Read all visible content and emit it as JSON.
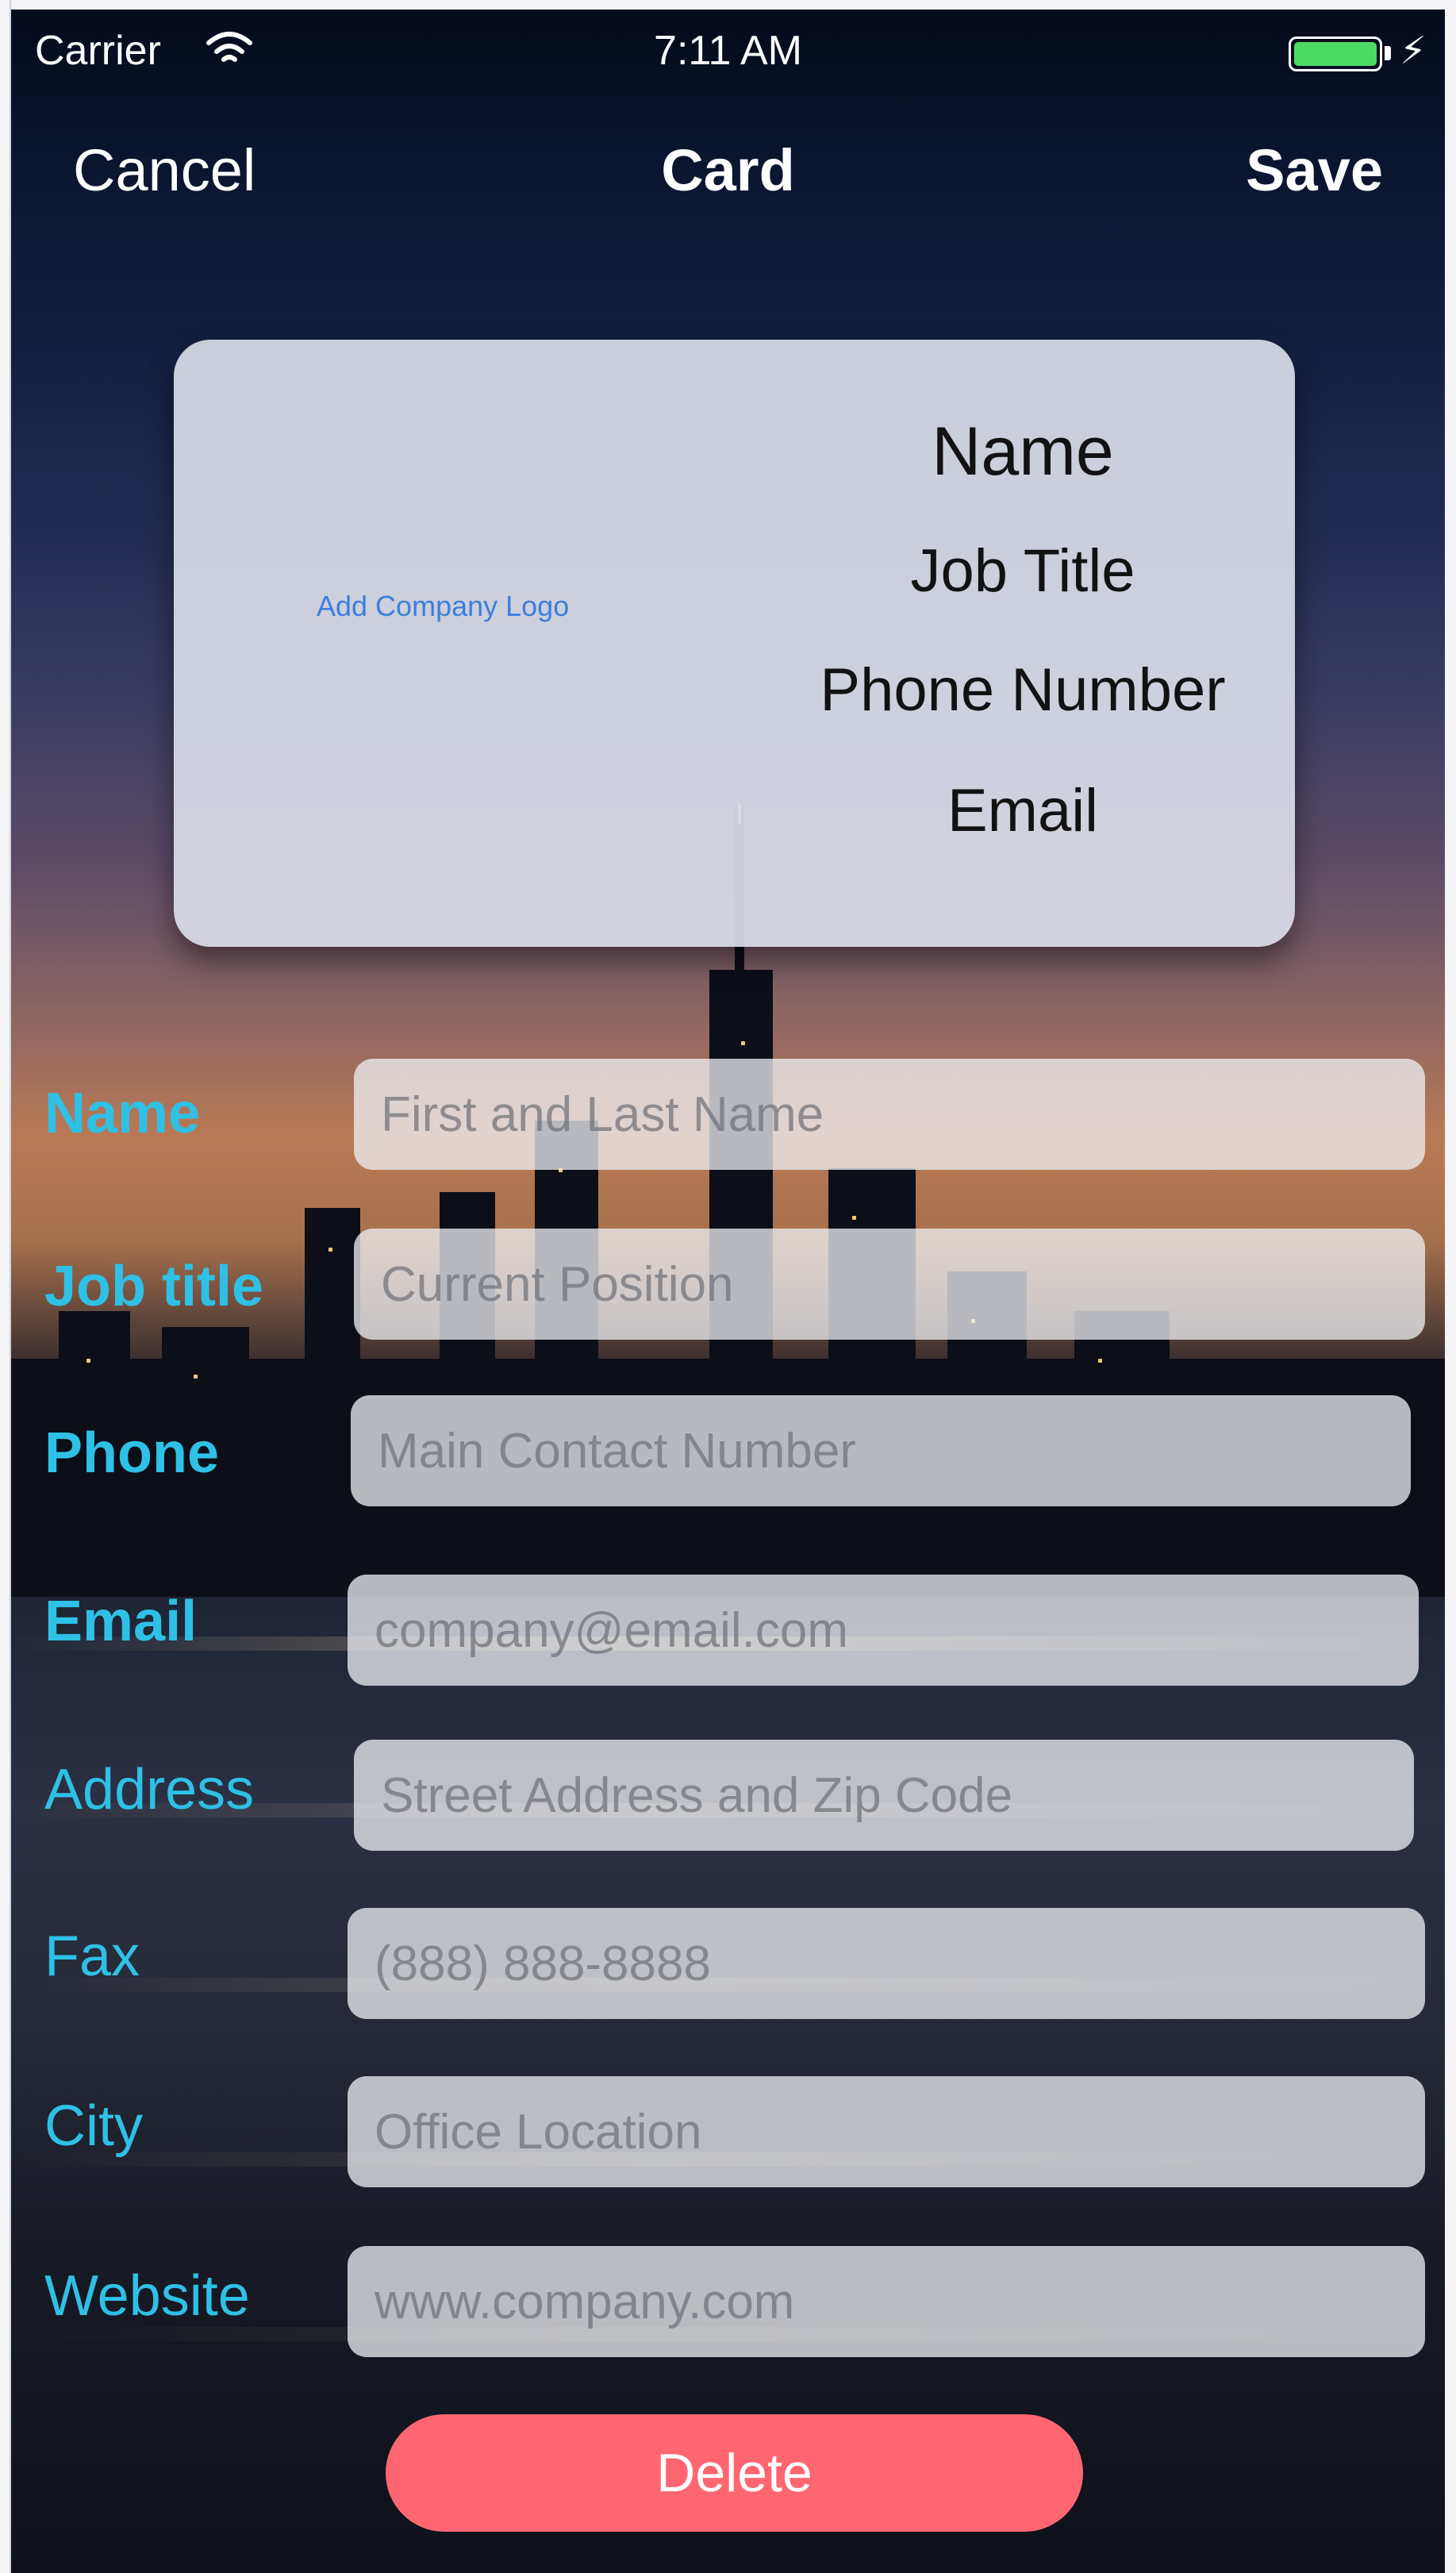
{
  "status_bar": {
    "carrier": "Carrier",
    "time": "7:11 AM",
    "battery_color": "#4cd964",
    "wifi_icon": "wifi-icon",
    "bolt_icon": "charging-bolt-icon"
  },
  "nav": {
    "cancel_label": "Cancel",
    "title": "Card",
    "save_label": "Save"
  },
  "card": {
    "logo_link": "Add Company Logo",
    "name": "Name",
    "job_title": "Job Title",
    "phone": "Phone Number",
    "email": "Email"
  },
  "form": {
    "name": {
      "label": "Name",
      "placeholder": "First and Last Name"
    },
    "job_title": {
      "label": "Job title",
      "placeholder": "Current Position"
    },
    "phone": {
      "label": "Phone",
      "placeholder": "Main Contact Number"
    },
    "email": {
      "label": "Email",
      "placeholder": "company@email.com"
    },
    "address": {
      "label": "Address",
      "placeholder": "Street Address and Zip Code"
    },
    "fax": {
      "label": "Fax",
      "placeholder": "(888) 888-8888"
    },
    "city": {
      "label": "City",
      "placeholder": "Office Location"
    },
    "website": {
      "label": "Website",
      "placeholder": "www.company.com"
    }
  },
  "delete_label": "Delete",
  "colors": {
    "label_accent": "#2fc0e6",
    "delete_button": "#ff6672",
    "logo_link": "#3d7fdd"
  }
}
